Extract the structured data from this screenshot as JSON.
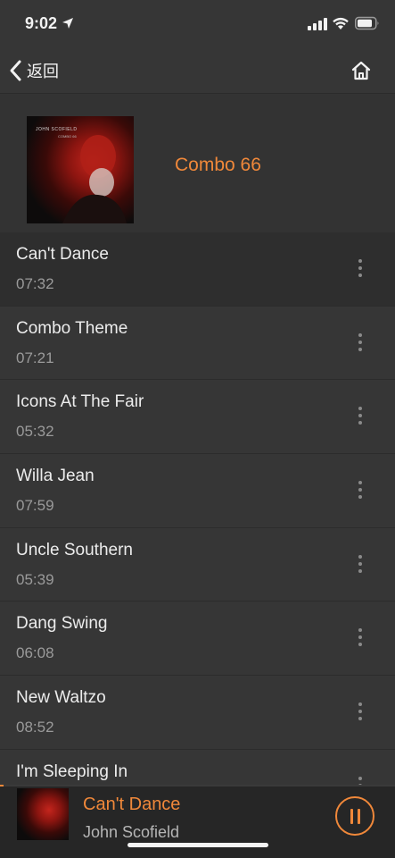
{
  "status_bar": {
    "time": "9:02"
  },
  "nav": {
    "back_label": "返回"
  },
  "album": {
    "title": "Combo 66",
    "cover_artist_text": "JOHN SCOFIELD",
    "cover_album_text": "COMBO 66"
  },
  "tracks": [
    {
      "title": "Can't Dance",
      "duration": "07:32"
    },
    {
      "title": "Combo Theme",
      "duration": "07:21"
    },
    {
      "title": "Icons At The Fair",
      "duration": "05:32"
    },
    {
      "title": "Willa Jean",
      "duration": "07:59"
    },
    {
      "title": "Uncle Southern",
      "duration": "05:39"
    },
    {
      "title": "Dang Swing",
      "duration": "06:08"
    },
    {
      "title": "New Waltzo",
      "duration": "08:52"
    },
    {
      "title": "I'm Sleeping In",
      "duration": ""
    }
  ],
  "player": {
    "title": "Can't Dance",
    "artist": "John Scofield",
    "progress": 0.01
  },
  "colors": {
    "accent": "#f0883a",
    "background": "#333333",
    "player_background": "#262626"
  },
  "icons": {
    "location": "location-arrow-icon",
    "signal": "cellular-signal-icon",
    "wifi": "wifi-icon",
    "battery": "battery-icon",
    "back": "chevron-left-icon",
    "home": "home-icon",
    "more": "more-vertical-icon",
    "pause": "pause-icon"
  }
}
